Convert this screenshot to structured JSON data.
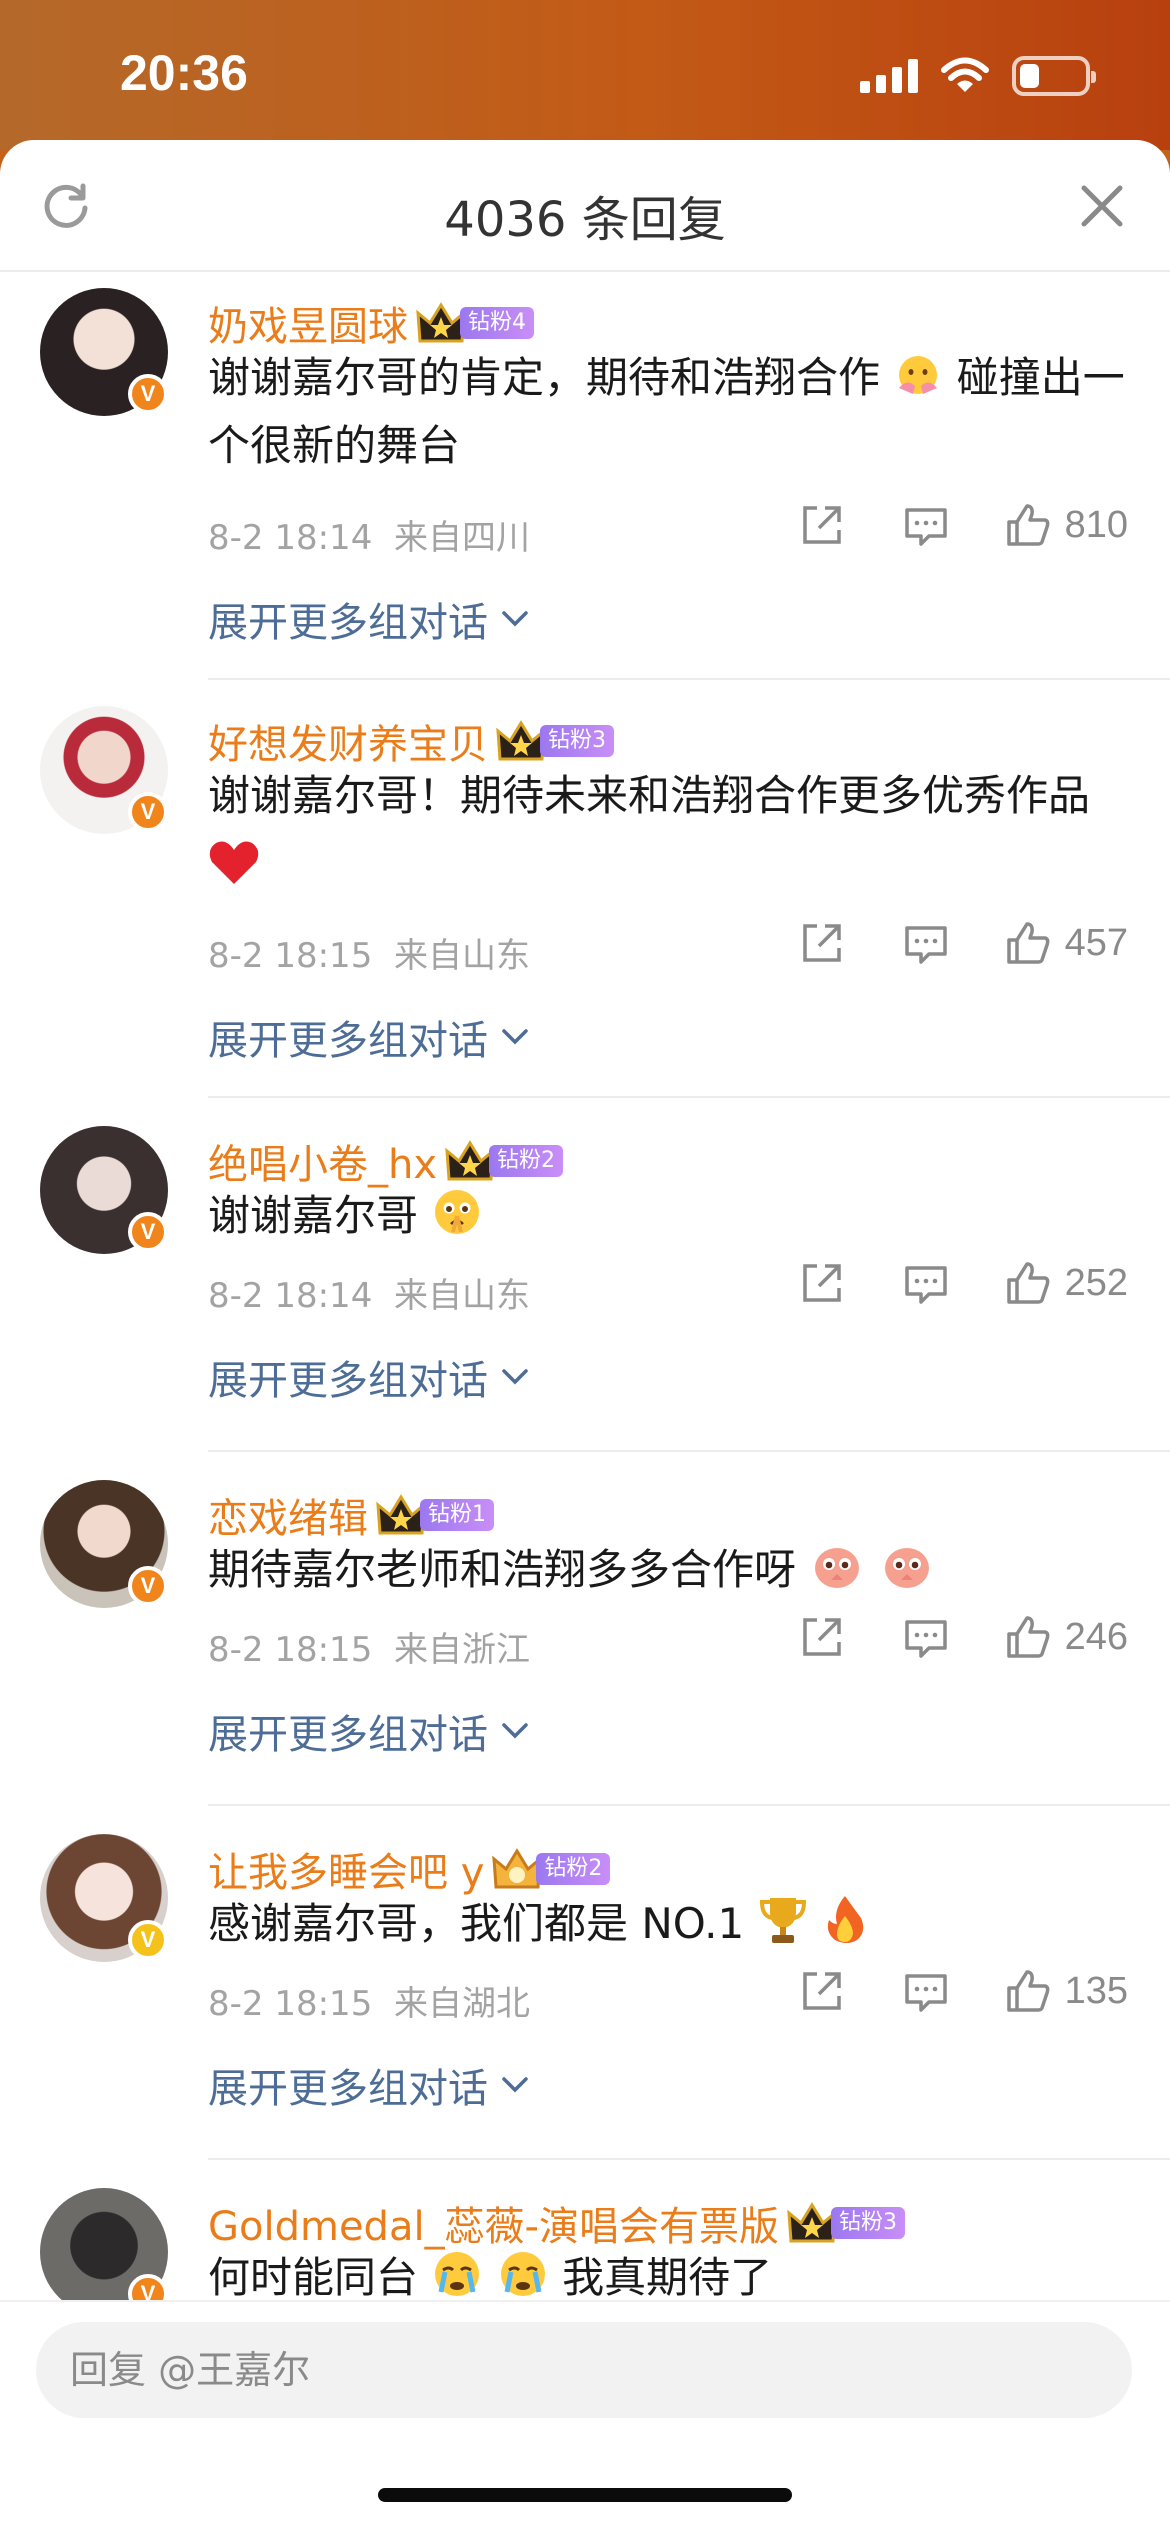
{
  "status_bar": {
    "time": "20:36",
    "battery_level": 0.3
  },
  "sheet": {
    "title": "4036 条回复"
  },
  "comments": [
    {
      "name": "奶戏昱圆球",
      "fan_tag": "钻粉4",
      "text": "谢谢嘉尔哥的肯定，期待和浩翔合作",
      "text_after": "碰撞出一个很新的舞台",
      "time": "8-2 18:14",
      "location": "来自四川",
      "likes": "810",
      "expand": "展开更多组对话",
      "verified": "V",
      "badge_color": "#f0851c"
    },
    {
      "name": "好想发财养宝贝",
      "fan_tag": "钻粉3",
      "text": "谢谢嘉尔哥！期待未来和浩翔合作更多优秀作品",
      "time": "8-2 18:15",
      "location": "来自山东",
      "likes": "457",
      "expand": "展开更多组对话",
      "verified": "V",
      "badge_color": "#f0851c"
    },
    {
      "name": "绝唱小卷_hx",
      "fan_tag": "钻粉2",
      "text": "谢谢嘉尔哥",
      "time": "8-2 18:14",
      "location": "来自山东",
      "likes": "252",
      "expand": "展开更多组对话",
      "verified": "V",
      "badge_color": "#f0851c"
    },
    {
      "name": "恋戏绪辑",
      "fan_tag": "钻粉1",
      "text": "期待嘉尔老师和浩翔多多合作呀",
      "time": "8-2 18:15",
      "location": "来自浙江",
      "likes": "246",
      "expand": "展开更多组对话",
      "verified": "V",
      "badge_color": "#f0851c"
    },
    {
      "name": "让我多睡会吧 y",
      "fan_tag": "钻粉2",
      "text": "感谢嘉尔哥，我们都是 NO.1",
      "time": "8-2 18:15",
      "location": "来自湖北",
      "likes": "135",
      "expand": "展开更多组对话",
      "verified": "V",
      "badge_color": "#f5c21c"
    },
    {
      "name": "Goldmedal_蕊薇-演唱会有票版",
      "fan_tag": "钻粉3",
      "text": "何时能同台",
      "text_after": "我真期待了",
      "verified": "V",
      "badge_color": "#f0851c"
    }
  ],
  "reply": {
    "placeholder": "回复 @王嘉尔"
  },
  "colors": {
    "username": "#ea7d19",
    "link": "#4e6d96",
    "accent": "#c4621a"
  },
  "icons": [
    "refresh-icon",
    "close-icon",
    "share-icon",
    "comment-icon",
    "like-icon",
    "chevron-down-icon",
    "crown-icon"
  ]
}
